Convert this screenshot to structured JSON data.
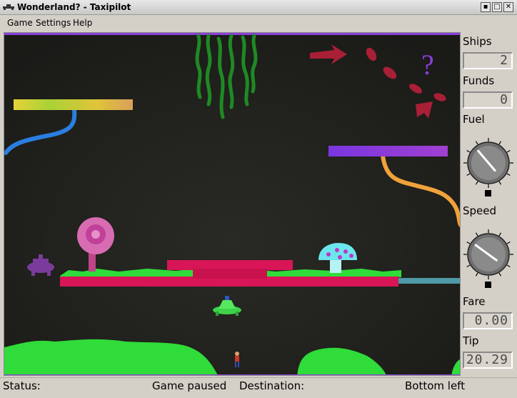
{
  "window": {
    "title": "Wonderland? - Taxipilot",
    "controls": [
      "minimize",
      "maximize",
      "close"
    ]
  },
  "menu": {
    "items": [
      {
        "label": "Game"
      },
      {
        "label": "Settings"
      },
      {
        "label": "Help"
      }
    ]
  },
  "panel": {
    "ships_label": "Ships",
    "ships_value": "2",
    "funds_label": "Funds",
    "funds_value": "0",
    "fuel_label": "Fuel",
    "fuel_level": 0.35,
    "speed_label": "Speed",
    "speed_level": 0.3,
    "fare_label": "Fare",
    "fare_value": "0.00",
    "tip_label": "Tip",
    "tip_value": "20.29"
  },
  "status": {
    "status_label": "Status:",
    "status_value": "Game paused",
    "destination_label": "Destination:",
    "destination_value": "Bottom left"
  },
  "scene": {
    "question_mark": "?",
    "colors": {
      "background": "#1f1f1b",
      "magenta_platform": "#d81557",
      "grass": "#2fdc3a",
      "taxi": "#3ed34a",
      "purple_platform": "#8a3dde",
      "arrows": "#c8223a"
    }
  }
}
